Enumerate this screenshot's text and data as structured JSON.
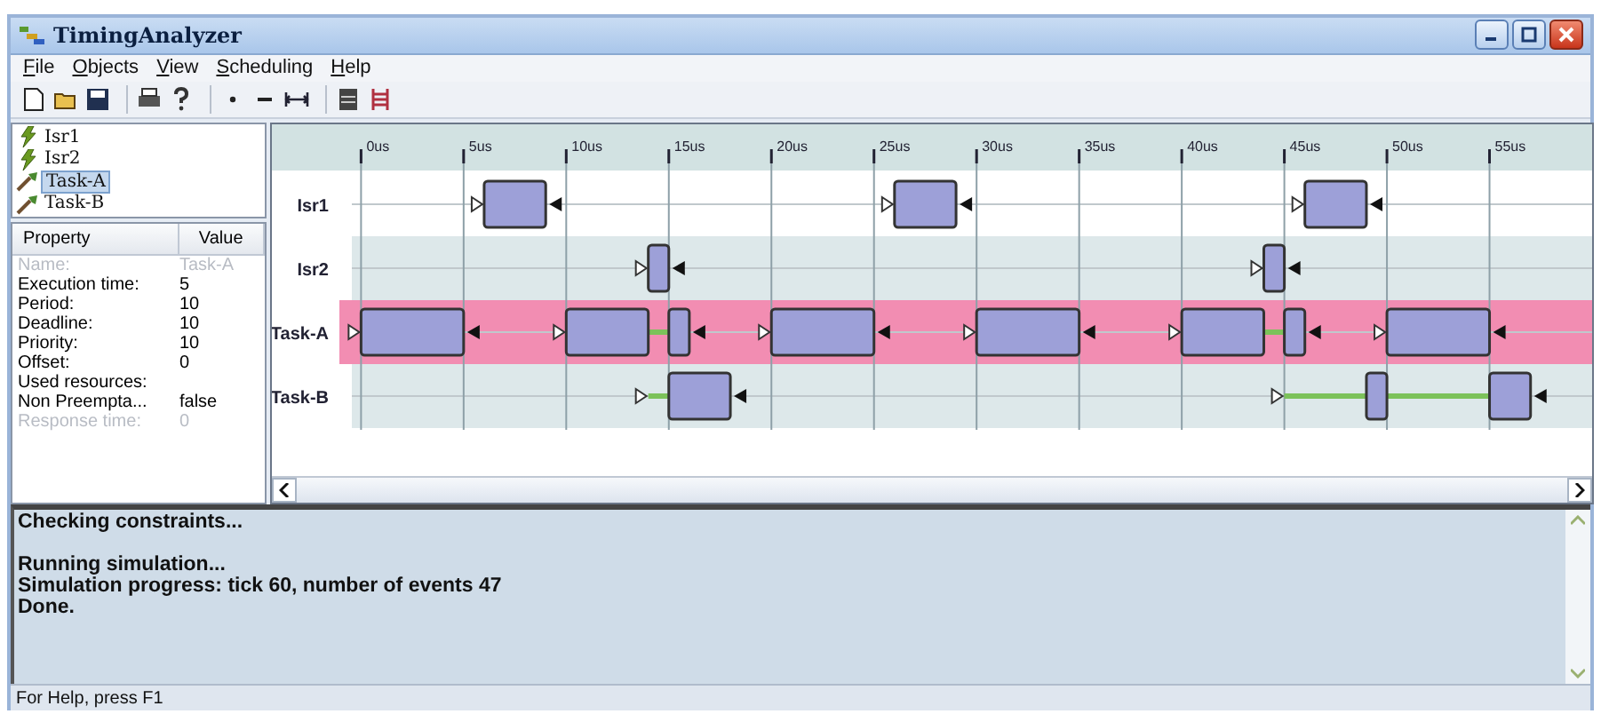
{
  "window": {
    "title": "TimingAnalyzer"
  },
  "menu": [
    {
      "label": "File"
    },
    {
      "label": "Objects"
    },
    {
      "label": "View"
    },
    {
      "label": "Scheduling"
    },
    {
      "label": "Help"
    }
  ],
  "tree": [
    {
      "label": "Isr1",
      "kind": "interrupt",
      "selected": false
    },
    {
      "label": "Isr2",
      "kind": "interrupt",
      "selected": false
    },
    {
      "label": "Task-A",
      "kind": "task",
      "selected": true
    },
    {
      "label": "Task-B",
      "kind": "task",
      "selected": false
    }
  ],
  "properties": {
    "columns": [
      "Property",
      "Value"
    ],
    "rows": [
      {
        "name": "Name:",
        "value": "Task-A",
        "disabled": true
      },
      {
        "name": "Execution time:",
        "value": "5",
        "disabled": false
      },
      {
        "name": "Period:",
        "value": "10",
        "disabled": false
      },
      {
        "name": "Deadline:",
        "value": "10",
        "disabled": false
      },
      {
        "name": "Priority:",
        "value": "10",
        "disabled": false
      },
      {
        "name": "Offset:",
        "value": "0",
        "disabled": false
      },
      {
        "name": "Used resources:",
        "disabled": false
      },
      {
        "name": "Non Preempta...",
        "value": "false",
        "disabled": false
      },
      {
        "name": "Response time:",
        "value": "0",
        "disabled": true
      }
    ]
  },
  "timeline": {
    "ticks": [
      "0us",
      "5us",
      "10us",
      "15us",
      "20us",
      "25us",
      "30us",
      "35us",
      "40us",
      "45us",
      "50us",
      "55us"
    ],
    "rows": [
      {
        "label": "Isr1",
        "highlighted": false
      },
      {
        "label": "Isr2",
        "highlighted": false
      },
      {
        "label": "Task-A",
        "highlighted": true
      },
      {
        "label": "Task-B",
        "highlighted": false
      }
    ]
  },
  "log": {
    "paragraphs": [
      [
        "Checking constraints..."
      ],
      [
        "Running simulation...",
        "Simulation progress: tick 60, number of events 47",
        "Done."
      ]
    ]
  },
  "status_bar": {
    "text": "For Help, press F1"
  }
}
